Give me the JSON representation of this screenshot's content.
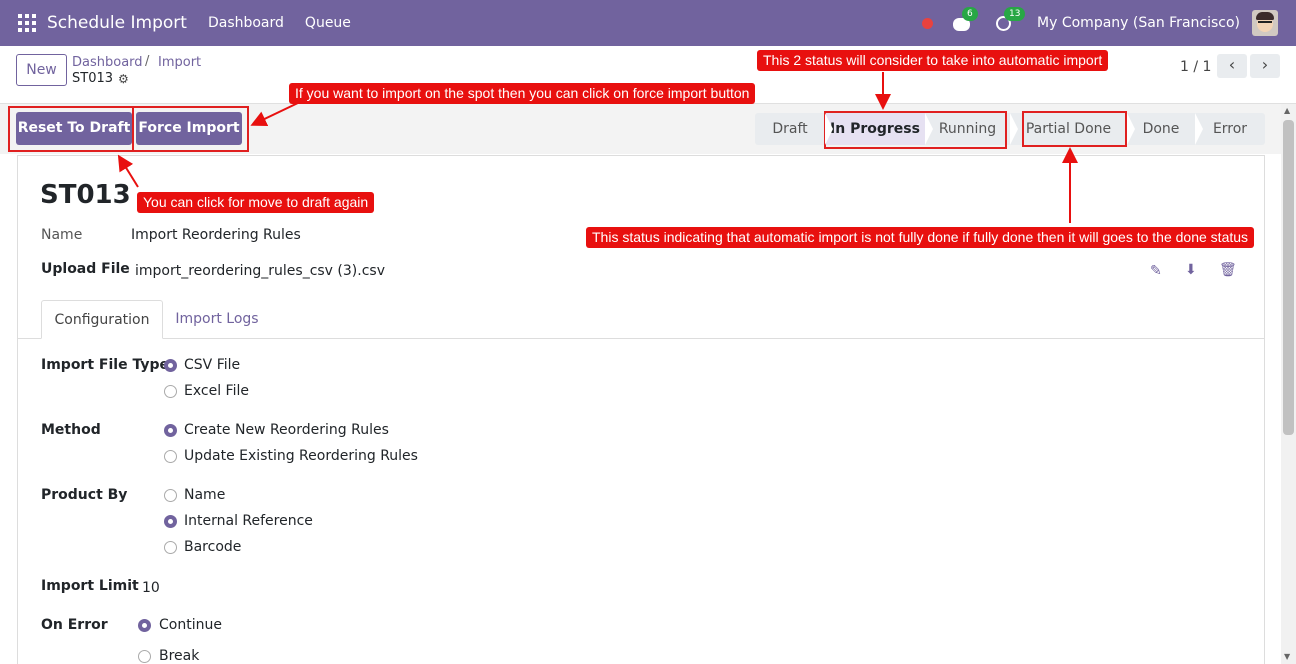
{
  "navbar": {
    "app_title": "Schedule Import",
    "menu": [
      "Dashboard",
      "Queue"
    ],
    "messages_count": "6",
    "activities_count": "13",
    "company": "My Company (San Francisco)"
  },
  "control": {
    "new_label": "New",
    "breadcrumb": [
      "Dashboard",
      "Import"
    ],
    "breadcrumb_sep": "/",
    "current_record": "ST013",
    "pager_text": "1 / 1",
    "prev_glyph": "‹",
    "next_glyph": "›"
  },
  "actions": {
    "reset_label": "Reset To Draft",
    "force_label": "Force Import"
  },
  "statusbar": {
    "stages": [
      "Draft",
      "In Progress",
      "Running",
      "Partial Done",
      "Done",
      "Error"
    ],
    "active": "In Progress"
  },
  "form": {
    "title": "ST013",
    "name_label": "Name",
    "name_value": "Import Reordering Rules",
    "upload_label": "Upload File",
    "upload_value": "import_reordering_rules_csv (3).csv",
    "tabs": [
      "Configuration",
      "Import Logs"
    ],
    "file_type_label": "Import File Type",
    "file_type_options": [
      "CSV File",
      "Excel File"
    ],
    "method_label": "Method",
    "method_options": [
      "Create New Reordering Rules",
      "Update Existing Reordering Rules"
    ],
    "product_by_label": "Product By",
    "product_by_options": [
      "Name",
      "Internal Reference",
      "Barcode"
    ],
    "limit_label": "Import Limit",
    "limit_value": "10",
    "on_error_label": "On Error",
    "on_error_options": [
      "Continue",
      "Break"
    ]
  },
  "annotations": {
    "status_note": "This 2 status will consider to take into automatic import",
    "force_note": "If you want to import on the spot then you can click on force import button",
    "draft_note": "You can click for move to draft again",
    "partial_note": "This status indicating that automatic import is not fully done if fully done then it will goes to the done status"
  },
  "colors": {
    "brand": "#71639e",
    "annotation": "#e8100f"
  }
}
